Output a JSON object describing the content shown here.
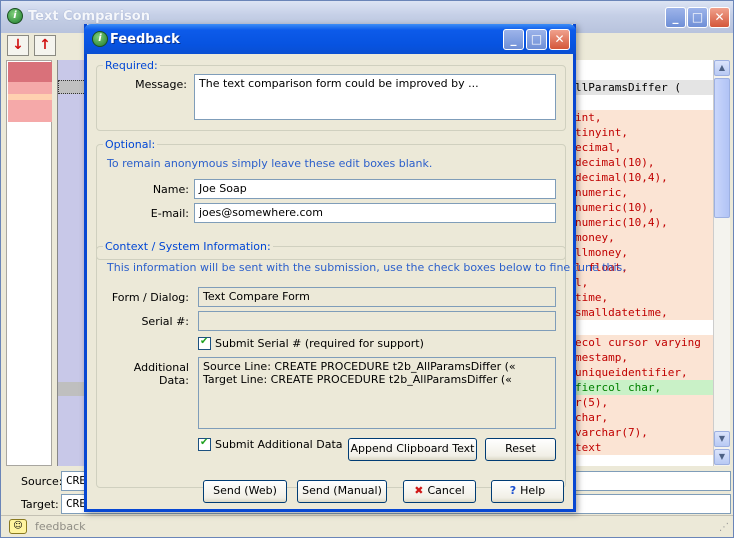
{
  "main": {
    "title": "Text Comparison",
    "source_label": "Source:",
    "target_label": "Target:",
    "source_value": "CRE",
    "target_value": "CRE",
    "status_text": "feedback",
    "code_header": "llParamsDiffer (",
    "code_lines": [
      "int,",
      "tinyint,",
      "ecimal,",
      "decimal(10),",
      "decimal(10,4),",
      "numeric,",
      "numeric(10),",
      "numeric(10,4),",
      "money,",
      "llmoney,",
      "l float,",
      "l,",
      "time,",
      "smalldatetime,",
      "",
      "ecol cursor varying",
      "mestamp,",
      " uniqueidentifier,",
      "fiercol char,",
      "r(5),",
      "char,",
      "varchar(7),",
      "text"
    ]
  },
  "dialog": {
    "title": "Feedback",
    "required": {
      "title": "Required:",
      "message_label": "Message:",
      "message_value": "The text comparison form could be improved by ..."
    },
    "optional": {
      "title": "Optional:",
      "hint": "To remain anonymous simply leave these edit boxes blank.",
      "name_label": "Name:",
      "name_value": "Joe Soap",
      "email_label": "E-mail:",
      "email_value": "joes@somewhere.com"
    },
    "context": {
      "title": "Context / System Information:",
      "hint": "This information will be sent with the submission, use the check boxes below to fine tune this.",
      "form_label": "Form / Dialog:",
      "form_value": "Text Compare Form",
      "serial_label": "Serial #:",
      "serial_value": "",
      "submit_serial_label": "Submit Serial # (required for support)",
      "additional_label": "Additional Data:",
      "additional_value": "Source Line: CREATE PROCEDURE t2b_AllParamsDiffer («\nTarget Line: CREATE PROCEDURE t2b_AllParamsDiffer («",
      "submit_additional_label": "Submit Additional Data",
      "append_button": "Append Clipboard Text",
      "reset_button": "Reset"
    },
    "buttons": {
      "send_web": "Send (Web)",
      "send_manual": "Send (Manual)",
      "cancel": "Cancel",
      "help": "Help"
    }
  }
}
